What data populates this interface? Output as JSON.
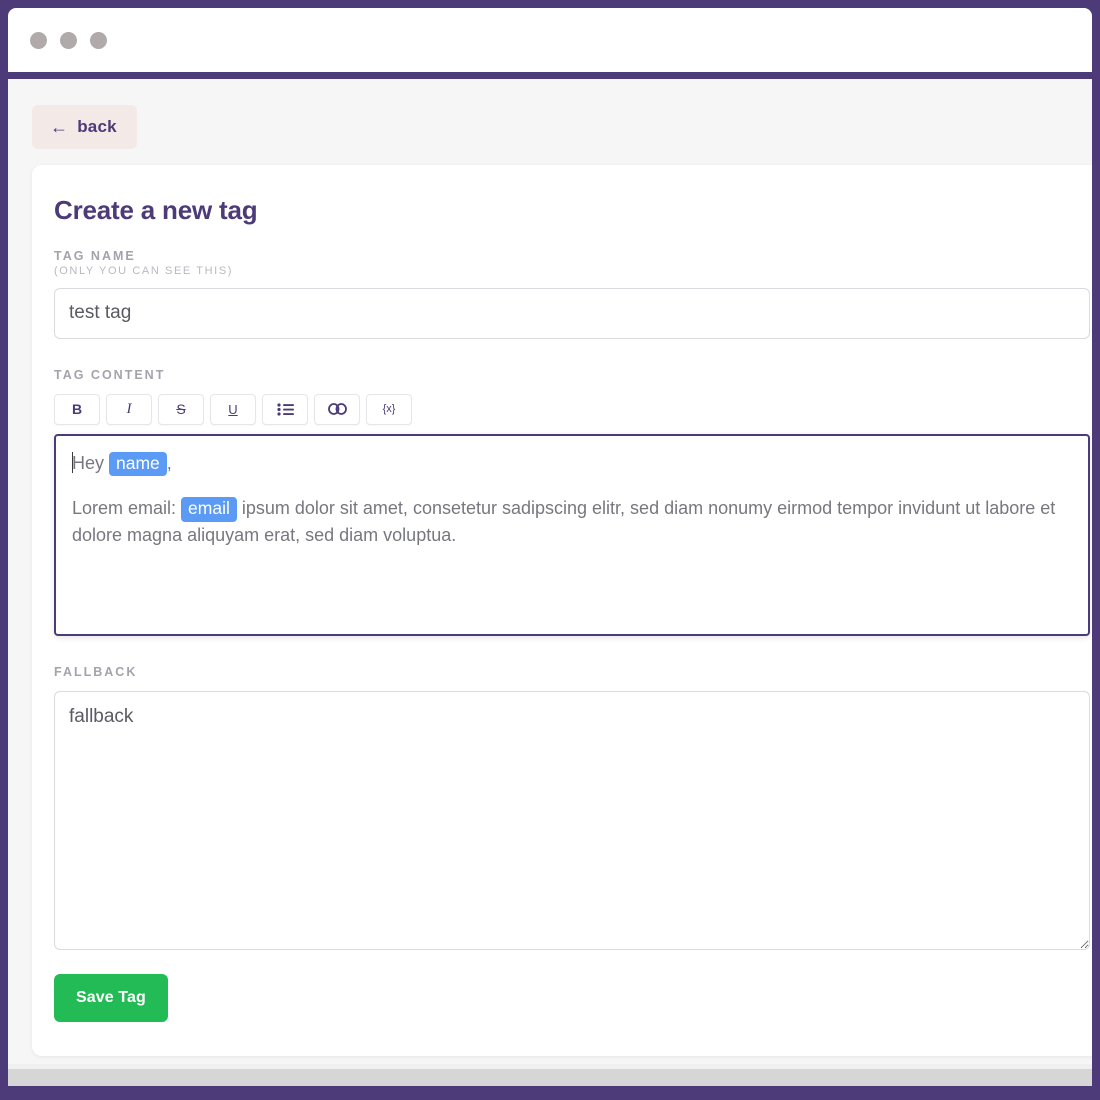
{
  "window": {
    "dots": [
      "close-dot",
      "minimize-dot",
      "maximize-dot"
    ],
    "frame_color": "#4c3b78",
    "titlebar_color": "#ffffff"
  },
  "nav": {
    "back_label": "back",
    "back_arrow": "←",
    "back_bg": "#f3e9e6",
    "back_text_color": "#4c3b78"
  },
  "card": {
    "title": "Create a new tag",
    "title_color": "#4c3b78"
  },
  "tag_name": {
    "label": "TAG NAME",
    "sublabel": "(ONLY YOU CAN SEE THIS)",
    "value": "test tag",
    "placeholder": "test tag"
  },
  "tag_content": {
    "label": "TAG CONTENT",
    "toolbar": [
      {
        "name": "bold-button",
        "label": "B",
        "icon": "bold-icon"
      },
      {
        "name": "italic-button",
        "label": "I",
        "icon": "italic-icon"
      },
      {
        "name": "strikethrough-button",
        "label": "S",
        "icon": "strikethrough-icon"
      },
      {
        "name": "underline-button",
        "label": "U",
        "icon": "underline-icon"
      },
      {
        "name": "bulleted-list-button",
        "label": "",
        "icon": "bulleted-list-icon"
      },
      {
        "name": "link-button",
        "label": "",
        "icon": "link-icon"
      },
      {
        "name": "variable-button",
        "label": "{x}",
        "icon": "variable-braces-icon"
      }
    ],
    "editor": {
      "focused": true,
      "border_color": "#4c3b78",
      "token_bg": "#5b9bf5",
      "token_text_color": "#ffffff",
      "line1_prefix": "Hey ",
      "line1_token": "name",
      "line1_suffix": ",",
      "line2_prefix": "Lorem email: ",
      "line2_token": "email",
      "line2_suffix": " ipsum dolor sit amet, consetetur sadipscing elitr, sed diam nonumy eirmod tempor invidunt ut labore et dolore magna aliquyam erat, sed diam voluptua."
    }
  },
  "fallback": {
    "label": "FALLBACK",
    "value": "fallback",
    "placeholder": "fallback"
  },
  "actions": {
    "save_label": "Save Tag",
    "save_bg": "#22bb55",
    "save_text_color": "#ffffff"
  }
}
